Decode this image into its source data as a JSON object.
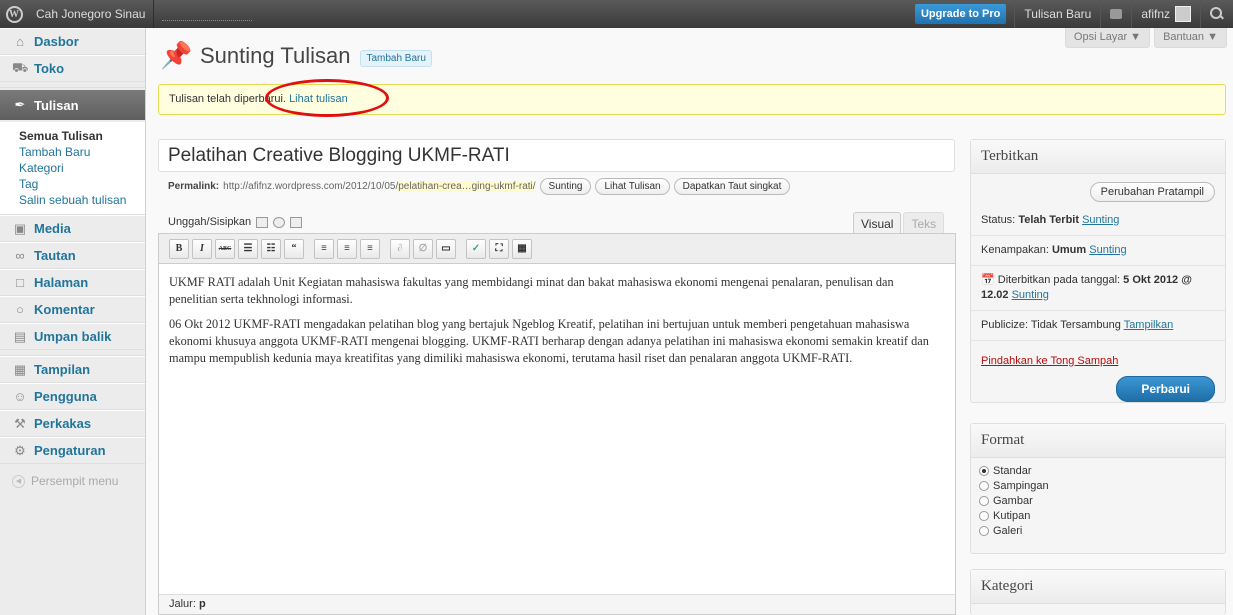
{
  "adminbar": {
    "site_name": "Cah Jonegoro Sinau",
    "upgrade_label": "Upgrade to Pro",
    "new_post_label": "Tulisan Baru",
    "user_name": "afifnz"
  },
  "screen_tabs": {
    "options": "Opsi Layar ▼",
    "help": "Bantuan ▼"
  },
  "sidebar": {
    "items": [
      {
        "label": "Dasbor",
        "icon": "⌂"
      },
      {
        "label": "Toko",
        "icon": "☖"
      },
      {
        "label": "Tulisan",
        "icon": "✒"
      },
      {
        "label": "Media",
        "icon": "▣"
      },
      {
        "label": "Tautan",
        "icon": "∞"
      },
      {
        "label": "Halaman",
        "icon": "□"
      },
      {
        "label": "Komentar",
        "icon": "○"
      },
      {
        "label": "Umpan balik",
        "icon": "▤"
      },
      {
        "label": "Tampilan",
        "icon": "▦"
      },
      {
        "label": "Pengguna",
        "icon": "☺"
      },
      {
        "label": "Perkakas",
        "icon": "⚒"
      },
      {
        "label": "Pengaturan",
        "icon": "⚙"
      }
    ],
    "submenu": [
      "Semua Tulisan",
      "Tambah Baru",
      "Kategori",
      "Tag",
      "Salin sebuah tulisan"
    ],
    "collapse_label": "Persempit menu"
  },
  "page": {
    "title": "Sunting Tulisan",
    "add_new": "Tambah Baru",
    "notice_text": "Tulisan telah diperbarui.",
    "notice_link": "Lihat tulisan"
  },
  "post": {
    "title": "Pelatihan Creative Blogging UKMF-RATI",
    "permalink_label": "Permalink:",
    "permalink_base": "http://afifnz.wordpress.com/2012/10/05/",
    "permalink_slug": "pelatihan-crea…ging-ukmf-rati",
    "permalink_end": "/",
    "edit_btn": "Sunting",
    "view_btn": "Lihat Tulisan",
    "shortlink_btn": "Dapatkan Taut singkat",
    "media_label": "Unggah/Sisipkan",
    "tab_visual": "Visual",
    "tab_text": "Teks",
    "paragraph1": "UKMF RATI adalah Unit Kegiatan mahasiswa fakultas yang membidangi minat dan bakat mahasiswa ekonomi mengenai penalaran, penulisan dan penelitian serta tekhnologi informasi.",
    "paragraph2": "06 Okt 2012 UKMF-RATI mengadakan pelatihan blog yang bertajuk Ngeblog Kreatif, pelatihan ini bertujuan untuk memberi pengetahuan mahasiswa ekonomi khusuya anggota UKMF-RATI mengenai blogging. UKMF-RATI berharap dengan adanya pelatihan ini mahasiswa ekonomi semakin kreatif dan mampu mempublish kedunia maya kreatifitas yang dimiliki mahasiswa ekonomi, terutama hasil riset dan penalaran anggota UKMF-RATI.",
    "path_label": "Jalur:",
    "path_value": "p"
  },
  "publish": {
    "title": "Terbitkan",
    "preview_btn": "Perubahan Pratampil",
    "status_label": "Status:",
    "status_value": "Telah Terbit",
    "visibility_label": "Kenampakan:",
    "visibility_value": "Umum",
    "published_label": "Diterbitkan pada tanggal:",
    "published_value": "5 Okt 2012 @ 12.02",
    "edit_link": "Sunting",
    "publicize_label": "Publicize: Tidak Tersambung",
    "publicize_link": "Tampilkan",
    "trash_link": "Pindahkan ke Tong Sampah",
    "update_btn": "Perbarui"
  },
  "format": {
    "title": "Format",
    "options": [
      "Standar",
      "Sampingan",
      "Gambar",
      "Kutipan",
      "Galeri"
    ]
  },
  "category": {
    "title": "Kategori"
  },
  "colors": {
    "accent": "#21759b",
    "highlight": "#e01010"
  }
}
